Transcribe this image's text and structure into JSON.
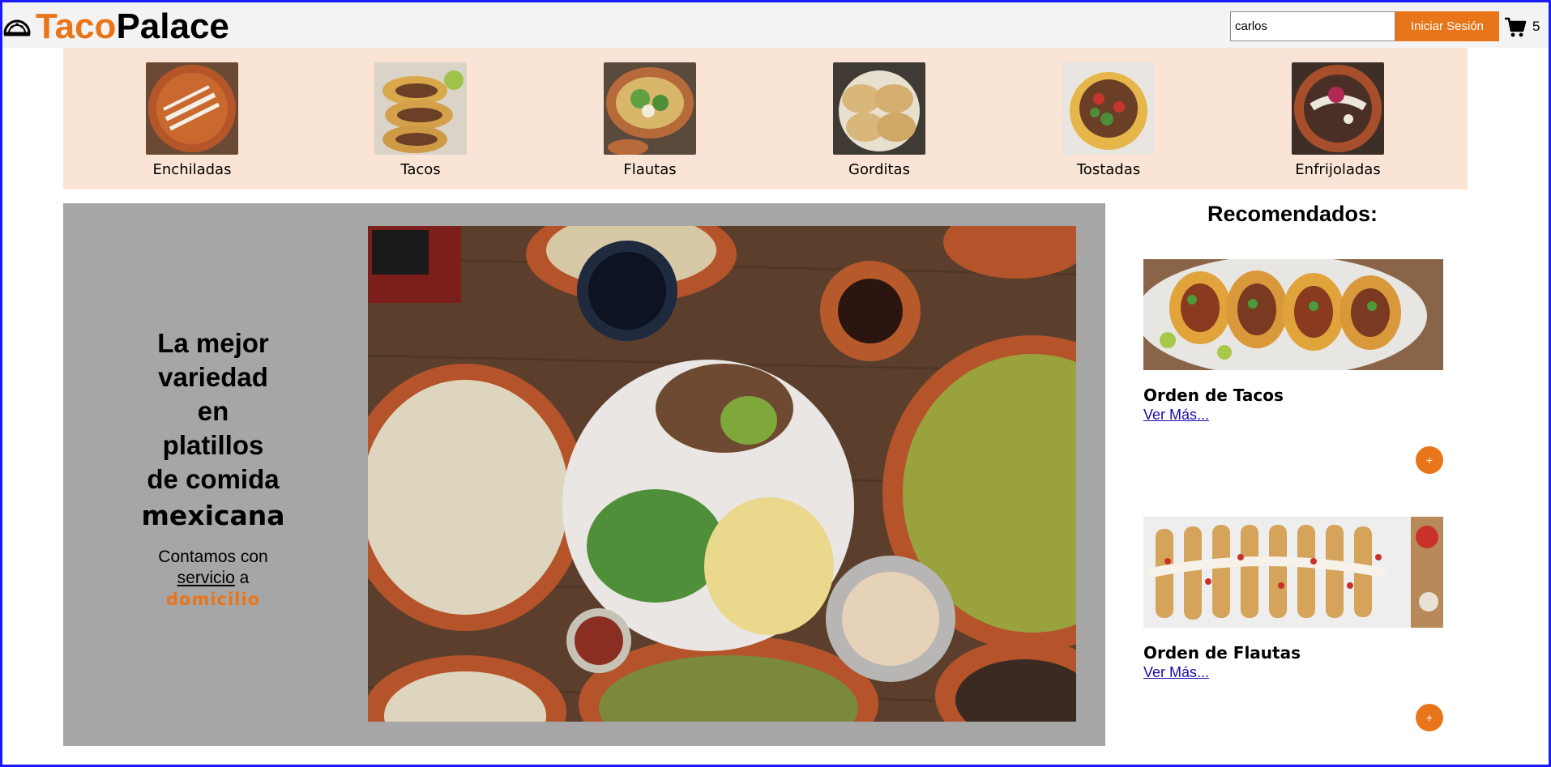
{
  "header": {
    "brand_part1": "Taco",
    "brand_part2": "Palace",
    "search_value": "carlos",
    "login_label": "Iniciar Sesión",
    "cart_count": "5"
  },
  "categories": [
    {
      "label": "Enchiladas"
    },
    {
      "label": "Tacos"
    },
    {
      "label": "Flautas"
    },
    {
      "label": "Gorditas"
    },
    {
      "label": "Tostadas"
    },
    {
      "label": "Enfrijoladas"
    }
  ],
  "hero": {
    "title_lines": [
      "La mejor",
      "variedad",
      "en",
      "platillos",
      "de comida"
    ],
    "emphasis": "mexicana",
    "sub_text_1": "Contamos con",
    "sub_link": "servicio",
    "sub_text_2": "a",
    "sub_accent": "domicilio"
  },
  "recommended": {
    "title": "Recomendados:",
    "items": [
      {
        "name": "Orden de Tacos",
        "link": "Ver Más...",
        "add_label": "+"
      },
      {
        "name": "Orden de Flautas",
        "link": "Ver Más...",
        "add_label": "+"
      }
    ]
  },
  "colors": {
    "accent": "#e8751a",
    "category_bg": "#f9e4d5",
    "hero_bg": "#a6a6a6",
    "link": "#1a0dab"
  }
}
